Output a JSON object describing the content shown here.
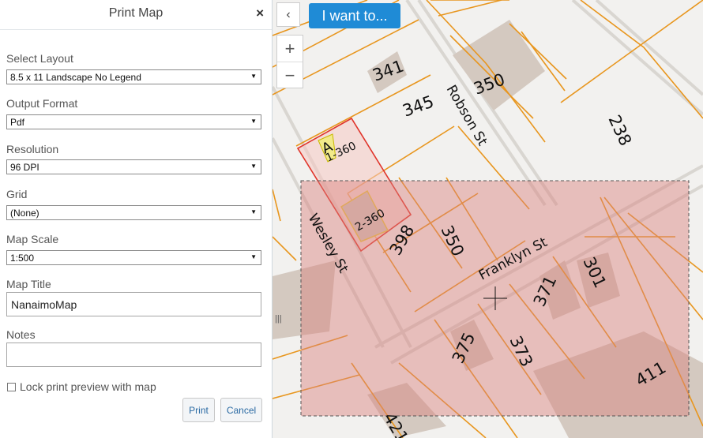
{
  "panel": {
    "title": "Print Map",
    "close": "×",
    "fields": {
      "layout": {
        "label": "Select Layout",
        "value": "8.5 x 11 Landscape No Legend"
      },
      "format": {
        "label": "Output Format",
        "value": "Pdf"
      },
      "resolution": {
        "label": "Resolution",
        "value": "96 DPI"
      },
      "grid": {
        "label": "Grid",
        "value": "(None)"
      },
      "scale": {
        "label": "Map Scale",
        "value": "1:500"
      },
      "title": {
        "label": "Map Title",
        "value": "NanaimoMap"
      },
      "notes": {
        "label": "Notes",
        "value": ""
      }
    },
    "lock_label": "Lock print preview with map",
    "print_button": "Print",
    "cancel_button": "Cancel"
  },
  "map": {
    "back_button": "‹",
    "want_button": "I want to...",
    "zoom_in": "+",
    "zoom_out": "−",
    "drag_handle": "|||",
    "streets": [
      "Robson St",
      "Franklyn St",
      "Wesley St"
    ],
    "parcels": [
      "341",
      "345",
      "350",
      "238",
      "350",
      "398",
      "371",
      "301",
      "373",
      "375",
      "411",
      "421"
    ],
    "unit_labels": [
      "1-360",
      "2-360",
      "A"
    ],
    "colors": {
      "parcel_line": "#e8961e",
      "print_area": "#d9817d",
      "selection": "#e0342a"
    }
  }
}
